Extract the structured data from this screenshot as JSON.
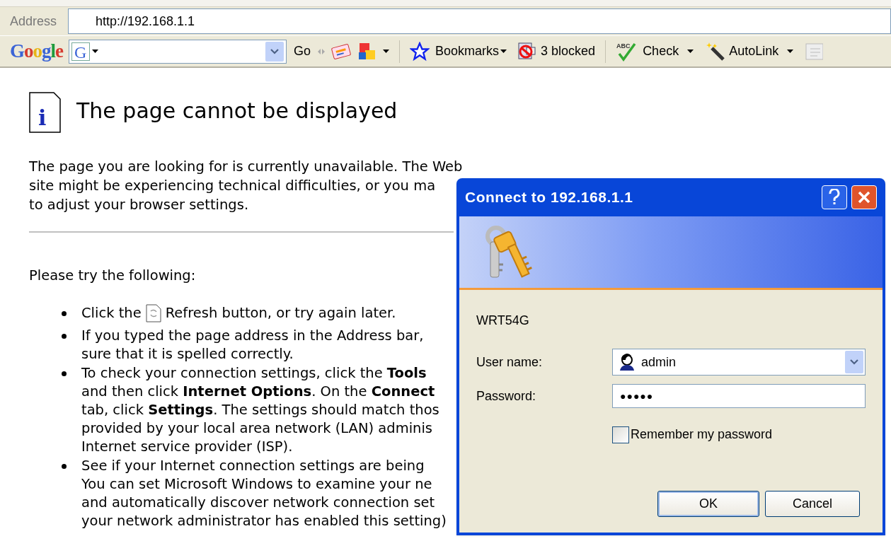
{
  "address_bar": {
    "label": "Address",
    "value": "http://192.168.1.1"
  },
  "google_toolbar": {
    "logo": "Google",
    "g_icon": "G",
    "spell_icon": "ABC",
    "search_button": "Go",
    "bookmarks": "Bookmarks",
    "blocked": "3 blocked",
    "check": "Check",
    "autolink": "AutoLink"
  },
  "page": {
    "info_icon": "i",
    "title": "The page cannot be displayed",
    "intro_lines": [
      "The page you are looking for is currently unavailable. The Web",
      "site might be experiencing technical difficulties, or you ma",
      "to adjust your browser settings."
    ],
    "try_heading": "Please try the following:",
    "bullets": [
      {
        "kind": "with-icon",
        "before": "Click the",
        "after": "Refresh button, or try again later."
      },
      {
        "kind": "text",
        "lines": [
          "If you typed the page address in the Address bar,",
          "sure that it is spelled correctly."
        ]
      },
      {
        "kind": "text",
        "lines": [
          "To check your connection settings, click the **Tools**",
          "and then click **Internet Options**. On the **Connect**",
          "tab, click **Settings**. The settings should match thos",
          "provided by your local area network (LAN) adminis",
          "Internet service provider (ISP)."
        ]
      },
      {
        "kind": "text",
        "lines": [
          "See if your Internet connection settings are being",
          "You can set Microsoft Windows to examine your ne",
          "and automatically discover network connection set",
          "your network administrator has enabled this setting)"
        ]
      }
    ]
  },
  "dialog": {
    "title": "Connect to 192.168.1.1",
    "realm": "WRT54G",
    "username_label": "User name:",
    "username": "admin",
    "password_label": "Password:",
    "password": "●●●●●",
    "remember": {
      "label": "Remember my password",
      "checked": false
    },
    "buttons": [
      "OK",
      "Cancel"
    ]
  }
}
